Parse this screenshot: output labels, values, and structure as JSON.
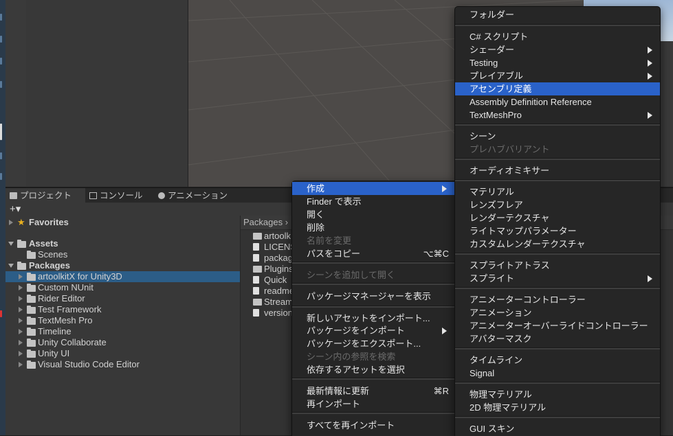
{
  "colors": {
    "highlight": "#2a62c9",
    "selection": "#2c5d87",
    "menu_bg": "#262626",
    "panel_bg": "#383838"
  },
  "tabs": [
    {
      "label": "プロジェクト",
      "icon": "folder-icon"
    },
    {
      "label": "コンソール",
      "icon": "console-icon"
    },
    {
      "label": "アニメーション",
      "icon": "clock-icon"
    }
  ],
  "toolbar": {
    "add": "+▾"
  },
  "tree": {
    "favorites": "Favorites",
    "assets": "Assets",
    "scenes": "Scenes",
    "packages": "Packages",
    "package_items": [
      "artoolkitX for Unity3D",
      "Custom NUnit",
      "Rider Editor",
      "Test Framework",
      "TextMesh Pro",
      "Timeline",
      "Unity Collaborate",
      "Unity UI",
      "Visual Studio Code Editor"
    ]
  },
  "files": {
    "breadcrumb": "Packages ›",
    "items": [
      "artoolk",
      "LICENS",
      "packag",
      "Plugins",
      "Quick",
      "readme",
      "Stream",
      "version"
    ]
  },
  "context_menu": {
    "items": [
      {
        "label": "作成",
        "submenu": true,
        "highlighted": true
      },
      {
        "label": "Finder で表示"
      },
      {
        "label": "開く"
      },
      {
        "label": "削除"
      },
      {
        "label": "名前を変更",
        "disabled": true
      },
      {
        "label": "パスをコピー",
        "shortcut": "⌥⌘C"
      },
      {
        "label": "シーンを追加して開く",
        "disabled": true
      },
      {
        "label": "パッケージマネージャーを表示"
      },
      {
        "label": "新しいアセットをインポート..."
      },
      {
        "label": "パッケージをインポート",
        "submenu": true
      },
      {
        "label": "パッケージをエクスポート..."
      },
      {
        "label": "シーン内の参照を検索",
        "disabled": true
      },
      {
        "label": "依存するアセットを選択"
      },
      {
        "label": "最新情報に更新",
        "shortcut": "⌘R"
      },
      {
        "label": "再インポート"
      },
      {
        "label": "すべてを再インポート"
      }
    ]
  },
  "create_menu": {
    "items": [
      {
        "label": "フォルダー"
      },
      {
        "label": "C# スクリプト"
      },
      {
        "label": "シェーダー",
        "submenu": true
      },
      {
        "label": "Testing",
        "submenu": true
      },
      {
        "label": "プレイアブル",
        "submenu": true
      },
      {
        "label": "アセンブリ定義",
        "highlighted": true
      },
      {
        "label": "Assembly Definition Reference"
      },
      {
        "label": "TextMeshPro",
        "submenu": true
      },
      {
        "label": "シーン"
      },
      {
        "label": "プレハブバリアント",
        "disabled": true
      },
      {
        "label": "オーディオミキサー"
      },
      {
        "label": "マテリアル"
      },
      {
        "label": "レンズフレア"
      },
      {
        "label": "レンダーテクスチャ"
      },
      {
        "label": "ライトマップパラメーター"
      },
      {
        "label": "カスタムレンダーテクスチャ"
      },
      {
        "label": "スプライトアトラス"
      },
      {
        "label": "スプライト",
        "submenu": true
      },
      {
        "label": "アニメーターコントローラー"
      },
      {
        "label": "アニメーション"
      },
      {
        "label": "アニメーターオーバーライドコントローラー"
      },
      {
        "label": "アバターマスク"
      },
      {
        "label": "タイムライン"
      },
      {
        "label": "Signal"
      },
      {
        "label": "物理マテリアル"
      },
      {
        "label": "2D 物理マテリアル"
      },
      {
        "label": "GUI スキン"
      }
    ]
  }
}
